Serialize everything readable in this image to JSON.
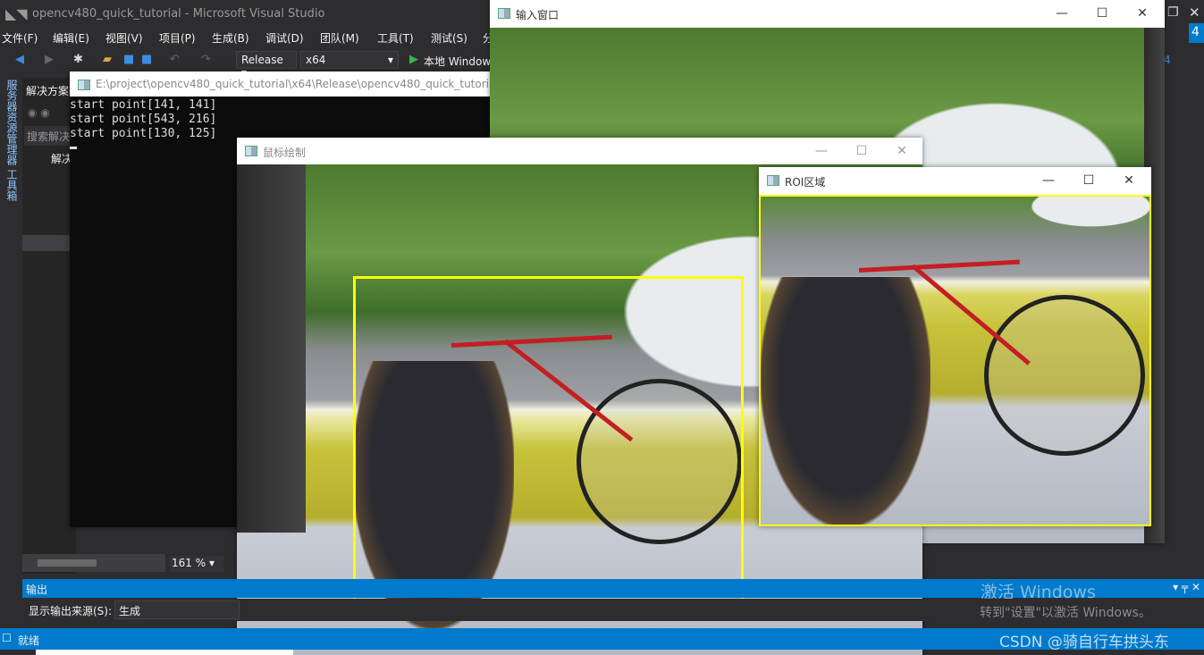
{
  "vs": {
    "title": "opencv480_quick_tutorial - Microsoft Visual Studio",
    "menu": [
      "文件(F)",
      "编辑(E)",
      "视图(V)",
      "项目(P)",
      "生成(B)",
      "调试(D)",
      "团队(M)",
      "工具(T)",
      "测试(S)",
      "分"
    ],
    "config": "Release",
    "platform": "x64",
    "run_label": "本地 Windows",
    "side_tabs": "服务器资源管理器 工具箱",
    "solution_title": "解决方案",
    "search": "搜索解决",
    "solution_root": "解决",
    "zoom": "161 %",
    "output_title": "输出",
    "output_source_label": "显示输出来源(S):",
    "output_source": "生成",
    "status": "就绪",
    "top_right_num": "4"
  },
  "console": {
    "title": "E:\\project\\opencv480_quick_tutorial\\x64\\Release\\opencv480_quick_tutorial.exe",
    "lines": [
      "start point[141, 141]",
      "start point[543, 216]",
      "start point[130, 125]"
    ]
  },
  "windows": {
    "input": "输入窗口",
    "draw": "鼠标绘制",
    "roi": "ROI区域"
  },
  "watermark": {
    "activate": "激活 Windows",
    "hint": "转到\"设置\"以激活 Windows。",
    "csdn": "CSDN @骑自行车拱头东"
  },
  "colors": {
    "accent": "#007acc",
    "roi_box": "#ffff00"
  }
}
